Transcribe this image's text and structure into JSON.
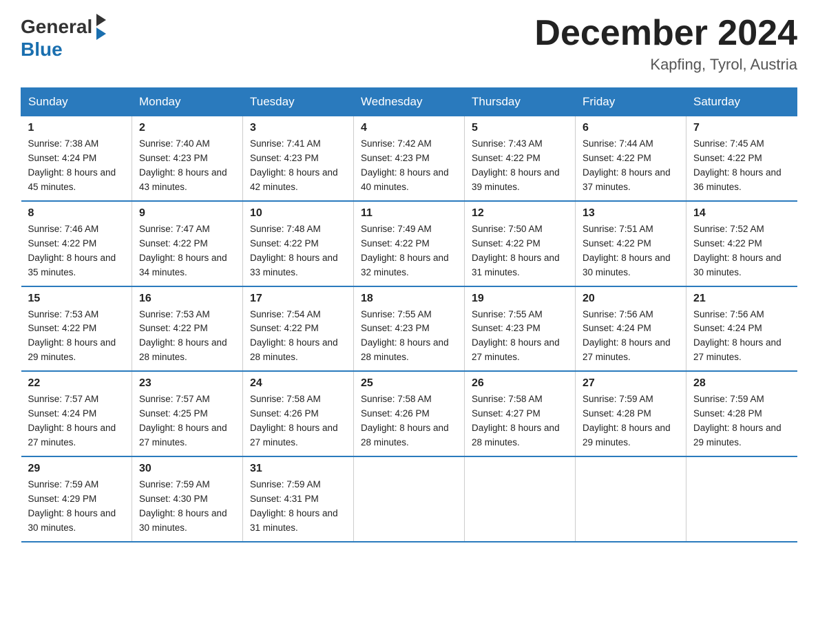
{
  "header": {
    "logo_general": "General",
    "logo_blue": "Blue",
    "month_title": "December 2024",
    "location": "Kapfing, Tyrol, Austria"
  },
  "days_of_week": [
    "Sunday",
    "Monday",
    "Tuesday",
    "Wednesday",
    "Thursday",
    "Friday",
    "Saturday"
  ],
  "weeks": [
    [
      {
        "day": "1",
        "sunrise": "7:38 AM",
        "sunset": "4:24 PM",
        "daylight": "8 hours and 45 minutes."
      },
      {
        "day": "2",
        "sunrise": "7:40 AM",
        "sunset": "4:23 PM",
        "daylight": "8 hours and 43 minutes."
      },
      {
        "day": "3",
        "sunrise": "7:41 AM",
        "sunset": "4:23 PM",
        "daylight": "8 hours and 42 minutes."
      },
      {
        "day": "4",
        "sunrise": "7:42 AM",
        "sunset": "4:23 PM",
        "daylight": "8 hours and 40 minutes."
      },
      {
        "day": "5",
        "sunrise": "7:43 AM",
        "sunset": "4:22 PM",
        "daylight": "8 hours and 39 minutes."
      },
      {
        "day": "6",
        "sunrise": "7:44 AM",
        "sunset": "4:22 PM",
        "daylight": "8 hours and 37 minutes."
      },
      {
        "day": "7",
        "sunrise": "7:45 AM",
        "sunset": "4:22 PM",
        "daylight": "8 hours and 36 minutes."
      }
    ],
    [
      {
        "day": "8",
        "sunrise": "7:46 AM",
        "sunset": "4:22 PM",
        "daylight": "8 hours and 35 minutes."
      },
      {
        "day": "9",
        "sunrise": "7:47 AM",
        "sunset": "4:22 PM",
        "daylight": "8 hours and 34 minutes."
      },
      {
        "day": "10",
        "sunrise": "7:48 AM",
        "sunset": "4:22 PM",
        "daylight": "8 hours and 33 minutes."
      },
      {
        "day": "11",
        "sunrise": "7:49 AM",
        "sunset": "4:22 PM",
        "daylight": "8 hours and 32 minutes."
      },
      {
        "day": "12",
        "sunrise": "7:50 AM",
        "sunset": "4:22 PM",
        "daylight": "8 hours and 31 minutes."
      },
      {
        "day": "13",
        "sunrise": "7:51 AM",
        "sunset": "4:22 PM",
        "daylight": "8 hours and 30 minutes."
      },
      {
        "day": "14",
        "sunrise": "7:52 AM",
        "sunset": "4:22 PM",
        "daylight": "8 hours and 30 minutes."
      }
    ],
    [
      {
        "day": "15",
        "sunrise": "7:53 AM",
        "sunset": "4:22 PM",
        "daylight": "8 hours and 29 minutes."
      },
      {
        "day": "16",
        "sunrise": "7:53 AM",
        "sunset": "4:22 PM",
        "daylight": "8 hours and 28 minutes."
      },
      {
        "day": "17",
        "sunrise": "7:54 AM",
        "sunset": "4:22 PM",
        "daylight": "8 hours and 28 minutes."
      },
      {
        "day": "18",
        "sunrise": "7:55 AM",
        "sunset": "4:23 PM",
        "daylight": "8 hours and 28 minutes."
      },
      {
        "day": "19",
        "sunrise": "7:55 AM",
        "sunset": "4:23 PM",
        "daylight": "8 hours and 27 minutes."
      },
      {
        "day": "20",
        "sunrise": "7:56 AM",
        "sunset": "4:24 PM",
        "daylight": "8 hours and 27 minutes."
      },
      {
        "day": "21",
        "sunrise": "7:56 AM",
        "sunset": "4:24 PM",
        "daylight": "8 hours and 27 minutes."
      }
    ],
    [
      {
        "day": "22",
        "sunrise": "7:57 AM",
        "sunset": "4:24 PM",
        "daylight": "8 hours and 27 minutes."
      },
      {
        "day": "23",
        "sunrise": "7:57 AM",
        "sunset": "4:25 PM",
        "daylight": "8 hours and 27 minutes."
      },
      {
        "day": "24",
        "sunrise": "7:58 AM",
        "sunset": "4:26 PM",
        "daylight": "8 hours and 27 minutes."
      },
      {
        "day": "25",
        "sunrise": "7:58 AM",
        "sunset": "4:26 PM",
        "daylight": "8 hours and 28 minutes."
      },
      {
        "day": "26",
        "sunrise": "7:58 AM",
        "sunset": "4:27 PM",
        "daylight": "8 hours and 28 minutes."
      },
      {
        "day": "27",
        "sunrise": "7:59 AM",
        "sunset": "4:28 PM",
        "daylight": "8 hours and 29 minutes."
      },
      {
        "day": "28",
        "sunrise": "7:59 AM",
        "sunset": "4:28 PM",
        "daylight": "8 hours and 29 minutes."
      }
    ],
    [
      {
        "day": "29",
        "sunrise": "7:59 AM",
        "sunset": "4:29 PM",
        "daylight": "8 hours and 30 minutes."
      },
      {
        "day": "30",
        "sunrise": "7:59 AM",
        "sunset": "4:30 PM",
        "daylight": "8 hours and 30 minutes."
      },
      {
        "day": "31",
        "sunrise": "7:59 AM",
        "sunset": "4:31 PM",
        "daylight": "8 hours and 31 minutes."
      },
      {
        "day": "",
        "sunrise": "",
        "sunset": "",
        "daylight": ""
      },
      {
        "day": "",
        "sunrise": "",
        "sunset": "",
        "daylight": ""
      },
      {
        "day": "",
        "sunrise": "",
        "sunset": "",
        "daylight": ""
      },
      {
        "day": "",
        "sunrise": "",
        "sunset": "",
        "daylight": ""
      }
    ]
  ]
}
